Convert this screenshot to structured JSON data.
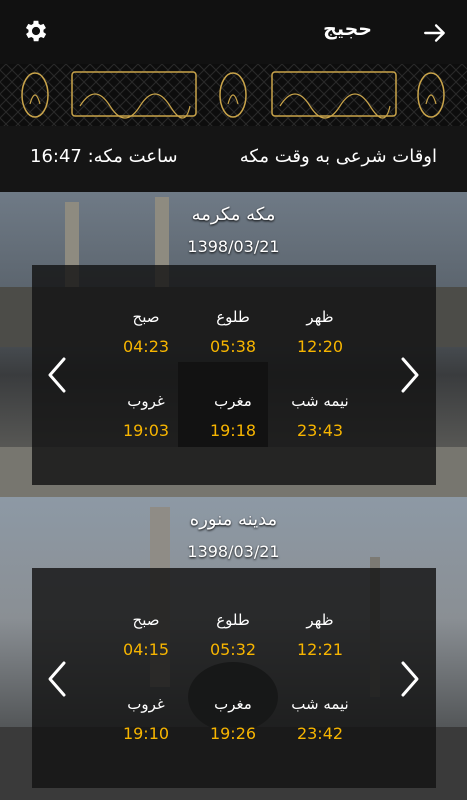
{
  "header": {
    "title": "حجیج",
    "settings_icon": "gear-icon",
    "back_icon": "arrow-right-icon"
  },
  "info": {
    "heading": "اوقات شرعی به وقت مکه",
    "clock_label": "ساعت مکه:",
    "clock_value": "16:47"
  },
  "cities": [
    {
      "name": "مکه مکرمه",
      "date": "1398/03/21",
      "prayers": [
        {
          "label": "ظهر",
          "time": "12:20"
        },
        {
          "label": "طلوع",
          "time": "05:38"
        },
        {
          "label": "صبح",
          "time": "04:23"
        },
        {
          "label": "نیمه شب",
          "time": "23:43"
        },
        {
          "label": "مغرب",
          "time": "19:18"
        },
        {
          "label": "غروب",
          "time": "19:03"
        }
      ]
    },
    {
      "name": "مدینه منوره",
      "date": "1398/03/21",
      "prayers": [
        {
          "label": "ظهر",
          "time": "12:21"
        },
        {
          "label": "طلوع",
          "time": "05:32"
        },
        {
          "label": "صبح",
          "time": "04:15"
        },
        {
          "label": "نیمه شب",
          "time": "23:42"
        },
        {
          "label": "مغرب",
          "time": "19:26"
        },
        {
          "label": "غروب",
          "time": "19:10"
        }
      ]
    }
  ],
  "colors": {
    "time_accent": "#f7b500",
    "gold": "#c9a44a"
  }
}
